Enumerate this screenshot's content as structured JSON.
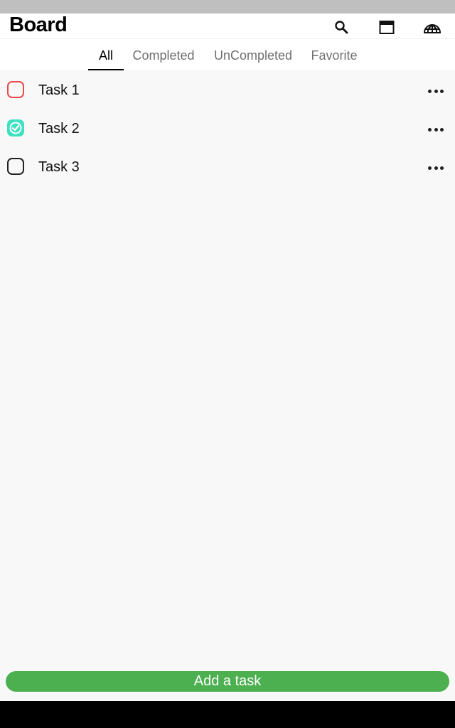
{
  "app_bar": {
    "title": "Board",
    "actions": [
      "search-icon",
      "calendar-icon",
      "globe-icon"
    ]
  },
  "tabs": [
    {
      "label": "All",
      "active": true
    },
    {
      "label": "Completed",
      "active": false
    },
    {
      "label": "UnCompleted",
      "active": false
    },
    {
      "label": "Favorite",
      "active": false
    }
  ],
  "tasks": [
    {
      "label": "Task 1",
      "checked": false,
      "color": "#e84a4a"
    },
    {
      "label": "Task 2",
      "checked": true,
      "color": "#3fe0c0"
    },
    {
      "label": "Task 3",
      "checked": false,
      "color": "#222222"
    }
  ],
  "add_button": {
    "label": "Add a task",
    "color": "#4caf50"
  }
}
